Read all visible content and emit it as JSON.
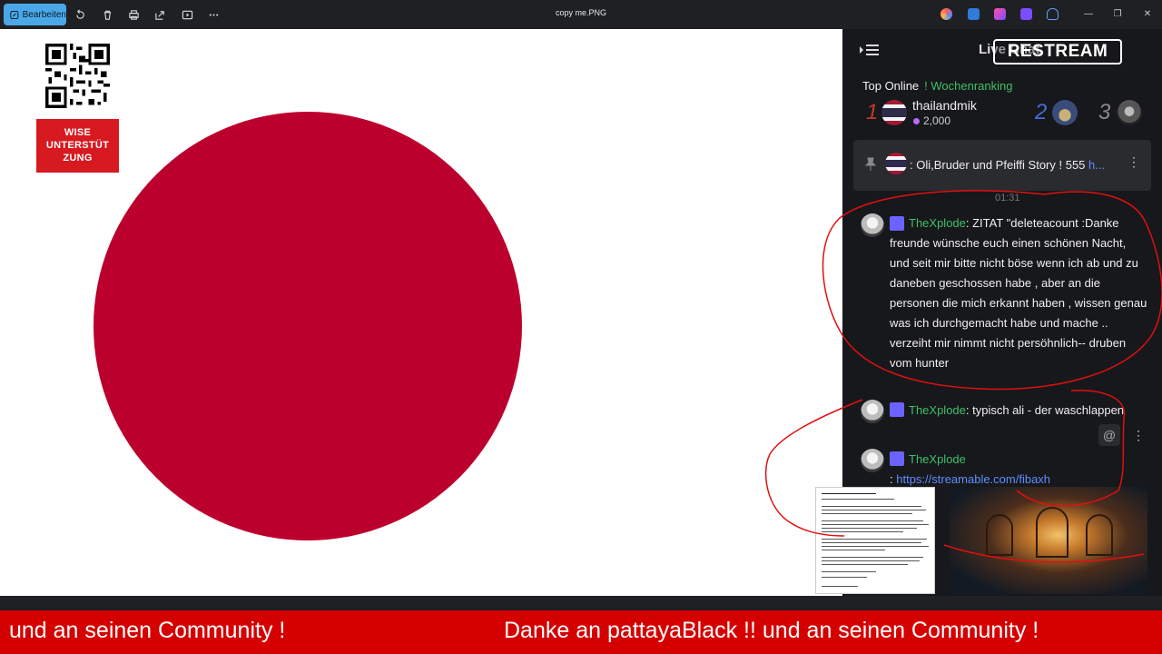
{
  "titlebar": {
    "edit_label": "Bearbeiten",
    "file_name": "copy me.PNG",
    "icons": [
      "rotate-icon",
      "delete-icon",
      "print-icon",
      "share-icon",
      "slideshow-icon",
      "more-icon"
    ],
    "window_controls": [
      "—",
      "❐",
      "✕"
    ]
  },
  "image": {
    "badge_text": "WISE\nUNTERSTÜT\nZUNG",
    "flag_color": "#bc002d"
  },
  "chat": {
    "header_title": "Live Chat",
    "restream_logo": "RESTREAM",
    "tabs": {
      "top_online": "Top Online",
      "weekly": "! Wochenranking"
    },
    "ranking": [
      {
        "rank": "1",
        "name": "thailandmik",
        "score": "2,000"
      },
      {
        "rank": "2"
      },
      {
        "rank": "3"
      }
    ],
    "pinned": {
      "prefix": ": Oli,Bruder und Pfeiffi Story ! 555 ",
      "more": "h..."
    },
    "timestamp": "01:31",
    "messages": [
      {
        "user": "TheXplode",
        "text": ": ZITAT \"deleteacount :Danke freunde wünsche euch einen schönen Nacht, und seit mir bitte nicht böse wenn ich ab und zu daneben geschossen habe , aber an die personen die mich erkannt haben , wissen genau was ich durchgemacht habe und mache .. verzeiht mir nimmt nicht persöhnlich-- druben vom hunter"
      },
      {
        "user": "TheXplode",
        "text": ": typisch ali - der waschlappen"
      },
      {
        "user": "TheXplode",
        "text": ": ",
        "link": "https://streamable.com/fibaxh"
      }
    ],
    "tools": {
      "mention": "@",
      "more": "⋮"
    },
    "colors": {
      "username": "#3fbf6b",
      "link": "#5f8dff",
      "annotation": "#e01010"
    }
  },
  "ticker": {
    "left_text": "und an seinen Community !",
    "right_text": "Danke an pattayaBlack !! und an seinen Community !"
  }
}
